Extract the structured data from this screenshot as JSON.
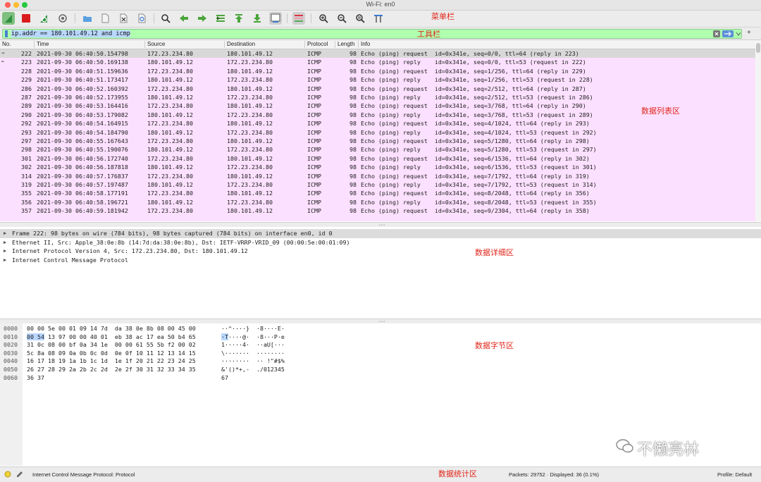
{
  "window": {
    "title": "Wi-Fi: en0"
  },
  "annotations": {
    "menu": "菜单栏",
    "toolbar": "工具栏",
    "packet_list": "数据列表区",
    "details": "数据详细区",
    "bytes": "数据字节区",
    "stats": "数据统计区"
  },
  "filter": {
    "value": "ip.addr == 180.101.49.12 and icmp"
  },
  "columns": {
    "no": "No.",
    "time": "Time",
    "source": "Source",
    "destination": "Destination",
    "protocol": "Protocol",
    "length": "Length",
    "info": "Info"
  },
  "packets": [
    {
      "no": "222",
      "time": "2021-09-30 06:40:50.154798",
      "src": "172.23.234.80",
      "dst": "180.101.49.12",
      "proto": "ICMP",
      "len": "98",
      "info": "Echo (ping) request  id=0x341e, seq=0/0, ttl=64 (reply in 223)"
    },
    {
      "no": "223",
      "time": "2021-09-30 06:40:50.169138",
      "src": "180.101.49.12",
      "dst": "172.23.234.80",
      "proto": "ICMP",
      "len": "98",
      "info": "Echo (ping) reply    id=0x341e, seq=0/0, ttl=53 (request in 222)"
    },
    {
      "no": "228",
      "time": "2021-09-30 06:40:51.159636",
      "src": "172.23.234.80",
      "dst": "180.101.49.12",
      "proto": "ICMP",
      "len": "98",
      "info": "Echo (ping) request  id=0x341e, seq=1/256, ttl=64 (reply in 229)"
    },
    {
      "no": "229",
      "time": "2021-09-30 06:40:51.173417",
      "src": "180.101.49.12",
      "dst": "172.23.234.80",
      "proto": "ICMP",
      "len": "98",
      "info": "Echo (ping) reply    id=0x341e, seq=1/256, ttl=53 (request in 228)"
    },
    {
      "no": "286",
      "time": "2021-09-30 06:40:52.160392",
      "src": "172.23.234.80",
      "dst": "180.101.49.12",
      "proto": "ICMP",
      "len": "98",
      "info": "Echo (ping) request  id=0x341e, seq=2/512, ttl=64 (reply in 287)"
    },
    {
      "no": "287",
      "time": "2021-09-30 06:40:52.173955",
      "src": "180.101.49.12",
      "dst": "172.23.234.80",
      "proto": "ICMP",
      "len": "98",
      "info": "Echo (ping) reply    id=0x341e, seq=2/512, ttl=53 (request in 286)"
    },
    {
      "no": "289",
      "time": "2021-09-30 06:40:53.164416",
      "src": "172.23.234.80",
      "dst": "180.101.49.12",
      "proto": "ICMP",
      "len": "98",
      "info": "Echo (ping) request  id=0x341e, seq=3/768, ttl=64 (reply in 290)"
    },
    {
      "no": "290",
      "time": "2021-09-30 06:40:53.179082",
      "src": "180.101.49.12",
      "dst": "172.23.234.80",
      "proto": "ICMP",
      "len": "98",
      "info": "Echo (ping) reply    id=0x341e, seq=3/768, ttl=53 (request in 289)"
    },
    {
      "no": "292",
      "time": "2021-09-30 06:40:54.164915",
      "src": "172.23.234.80",
      "dst": "180.101.49.12",
      "proto": "ICMP",
      "len": "98",
      "info": "Echo (ping) request  id=0x341e, seq=4/1024, ttl=64 (reply in 293)"
    },
    {
      "no": "293",
      "time": "2021-09-30 06:40:54.184790",
      "src": "180.101.49.12",
      "dst": "172.23.234.80",
      "proto": "ICMP",
      "len": "98",
      "info": "Echo (ping) reply    id=0x341e, seq=4/1024, ttl=53 (request in 292)"
    },
    {
      "no": "297",
      "time": "2021-09-30 06:40:55.167643",
      "src": "172.23.234.80",
      "dst": "180.101.49.12",
      "proto": "ICMP",
      "len": "98",
      "info": "Echo (ping) request  id=0x341e, seq=5/1280, ttl=64 (reply in 298)"
    },
    {
      "no": "298",
      "time": "2021-09-30 06:40:55.190076",
      "src": "180.101.49.12",
      "dst": "172.23.234.80",
      "proto": "ICMP",
      "len": "98",
      "info": "Echo (ping) reply    id=0x341e, seq=5/1280, ttl=53 (request in 297)"
    },
    {
      "no": "301",
      "time": "2021-09-30 06:40:56.172740",
      "src": "172.23.234.80",
      "dst": "180.101.49.12",
      "proto": "ICMP",
      "len": "98",
      "info": "Echo (ping) request  id=0x341e, seq=6/1536, ttl=64 (reply in 302)"
    },
    {
      "no": "302",
      "time": "2021-09-30 06:40:56.187818",
      "src": "180.101.49.12",
      "dst": "172.23.234.80",
      "proto": "ICMP",
      "len": "98",
      "info": "Echo (ping) reply    id=0x341e, seq=6/1536, ttl=53 (request in 301)"
    },
    {
      "no": "314",
      "time": "2021-09-30 06:40:57.176837",
      "src": "172.23.234.80",
      "dst": "180.101.49.12",
      "proto": "ICMP",
      "len": "98",
      "info": "Echo (ping) request  id=0x341e, seq=7/1792, ttl=64 (reply in 319)"
    },
    {
      "no": "319",
      "time": "2021-09-30 06:40:57.197487",
      "src": "180.101.49.12",
      "dst": "172.23.234.80",
      "proto": "ICMP",
      "len": "98",
      "info": "Echo (ping) reply    id=0x341e, seq=7/1792, ttl=53 (request in 314)"
    },
    {
      "no": "355",
      "time": "2021-09-30 06:40:58.177191",
      "src": "172.23.234.80",
      "dst": "180.101.49.12",
      "proto": "ICMP",
      "len": "98",
      "info": "Echo (ping) request  id=0x341e, seq=8/2048, ttl=64 (reply in 356)"
    },
    {
      "no": "356",
      "time": "2021-09-30 06:40:58.196721",
      "src": "180.101.49.12",
      "dst": "172.23.234.80",
      "proto": "ICMP",
      "len": "98",
      "info": "Echo (ping) reply    id=0x341e, seq=8/2048, ttl=53 (request in 355)"
    },
    {
      "no": "357",
      "time": "2021-09-30 06:40:59.181942",
      "src": "172.23.234.80",
      "dst": "180.101.49.12",
      "proto": "ICMP",
      "len": "98",
      "info": "Echo (ping) request  id=0x341e, seq=9/2304, ttl=64 (reply in 358)"
    }
  ],
  "details": [
    "Frame 222: 98 bytes on wire (784 bits), 98 bytes captured (784 bits) on interface en0, id 0",
    "Ethernet II, Src: Apple_38:0e:8b (14:7d:da:38:0e:8b), Dst: IETF-VRRP-VRID_09 (00:00:5e:00:01:09)",
    "Internet Protocol Version 4, Src: 172.23.234.80, Dst: 180.101.49.12",
    "Internet Control Message Protocol"
  ],
  "bytes": [
    {
      "off": "0000",
      "hex": "00 00 5e 00 01 09 14 7d  da 38 0e 8b 08 00 45 00",
      "ascii": "··^····}  ·8····E·"
    },
    {
      "off": "0010",
      "hex_hl": "00 54",
      "hex": " 13 97 00 00 40 01  eb 38 ac 17 ea 50 b4 65",
      "ascii_hl": "·T",
      "ascii": "····@·  ·8···P·e"
    },
    {
      "off": "0020",
      "hex": "31 0c 08 00 bf 0a 34 1e  00 00 61 55 5b f2 00 02",
      "ascii": "1·····4·  ··aU[···"
    },
    {
      "off": "0030",
      "hex": "5c 8a 08 09 0a 0b 0c 0d  0e 0f 10 11 12 13 14 15",
      "ascii": "\\·······  ········"
    },
    {
      "off": "0040",
      "hex": "16 17 18 19 1a 1b 1c 1d  1e 1f 20 21 22 23 24 25",
      "ascii": "········  ·· !\"#$%"
    },
    {
      "off": "0050",
      "hex": "26 27 28 29 2a 2b 2c 2d  2e 2f 30 31 32 33 34 35",
      "ascii": "&'()*+,-  ./012345"
    },
    {
      "off": "0060",
      "hex": "36 37",
      "ascii": "67"
    }
  ],
  "status": {
    "left": "Internet Control Message Protocol: Protocol",
    "packets": "Packets: 29752 · Displayed: 36 (0.1%)",
    "profile": "Profile: Default"
  },
  "watermark": "不懒亮林",
  "colors": {
    "filter_ok": "#afffaf",
    "icmp_row": "#fce0ff",
    "annotation": "#e0261b"
  }
}
